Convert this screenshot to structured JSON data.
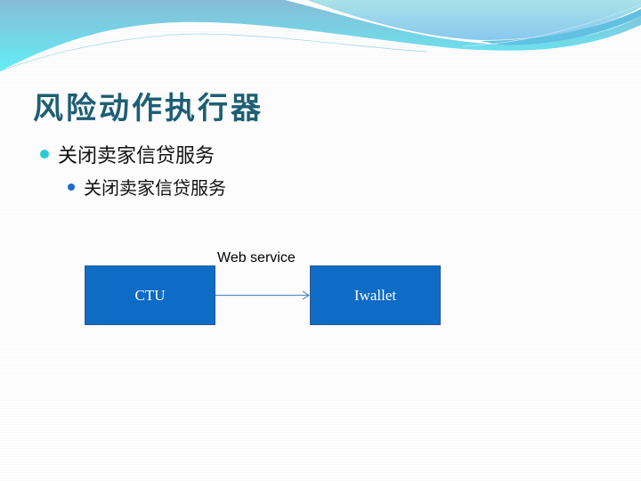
{
  "slide": {
    "title": "风险动作执行器",
    "bullets": [
      {
        "level": 1,
        "text": "关闭卖家信贷服务",
        "bullet_color": "#2ccad8"
      },
      {
        "level": 2,
        "text": "关闭卖家信贷服务",
        "bullet_color": "#1e6ec9"
      }
    ]
  },
  "diagram": {
    "nodes": [
      {
        "id": "ctu",
        "label": "CTU",
        "fill": "#0f6cc6"
      },
      {
        "id": "iwallet",
        "label": "Iwallet",
        "fill": "#0f6cc6"
      }
    ],
    "edges": [
      {
        "from": "ctu",
        "to": "iwallet",
        "label": "Web service",
        "color": "#5b8fc7"
      }
    ]
  },
  "theme": {
    "title_color": "#1d5f74",
    "wave_colors": [
      "#86bed6",
      "#5fe6f2",
      "#8fd3ea",
      "#46b6dd"
    ]
  }
}
